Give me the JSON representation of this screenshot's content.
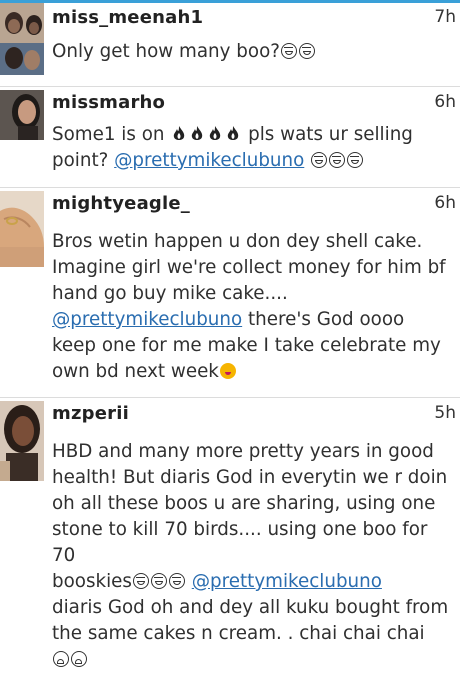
{
  "comments": [
    {
      "username": "miss_meenah1",
      "time": "7h",
      "text_1": "Only get how many boo?",
      "emoji": [
        "laughing-crying-emoji",
        "laughing-crying-emoji"
      ]
    },
    {
      "username": "missmarho",
      "time": "6h",
      "text_1": "Some1 is on",
      "text_2": "pls wats ur selling",
      "text_3": "point?",
      "mention": "@prettymikeclubuno",
      "emoji": [
        "fire-emoji",
        "fire-emoji",
        "fire-emoji",
        "fire-emoji",
        "laughing-crying-emoji",
        "laughing-crying-emoji",
        "laughing-crying-emoji"
      ]
    },
    {
      "username": "mightyeagle_",
      "time": "6h",
      "line_1": "Bros wetin happen u don dey shell cake.",
      "line_2": "Imagine girl we're collect money for him bf",
      "line_3": "hand go buy mike cake....",
      "mention": "@prettymikeclubuno",
      "line_4_rest": "there's God oooo",
      "line_5": "keep one for me make I take celebrate my",
      "line_6": "own bd next week",
      "emoji": [
        "winking-tongue-emoji"
      ]
    },
    {
      "username": "mzperii",
      "time": "5h",
      "line_1": "HBD and many more pretty years in good",
      "line_2": "health! But diaris God in everytin we r doin",
      "line_3": "oh all these boos u are sharing, using one",
      "line_4": "stone to kill 70 birds.... using one boo for 70",
      "line_5_start": "booskies",
      "mention": "@prettymikeclubuno",
      "line_6": "diaris God oh and dey all kuku bought from",
      "line_7": "the same cakes n cream. . chai chai chai",
      "emoji": [
        "laughing-crying-emoji",
        "laughing-crying-emoji",
        "laughing-crying-emoji",
        "weary-emoji",
        "weary-emoji"
      ]
    }
  ]
}
